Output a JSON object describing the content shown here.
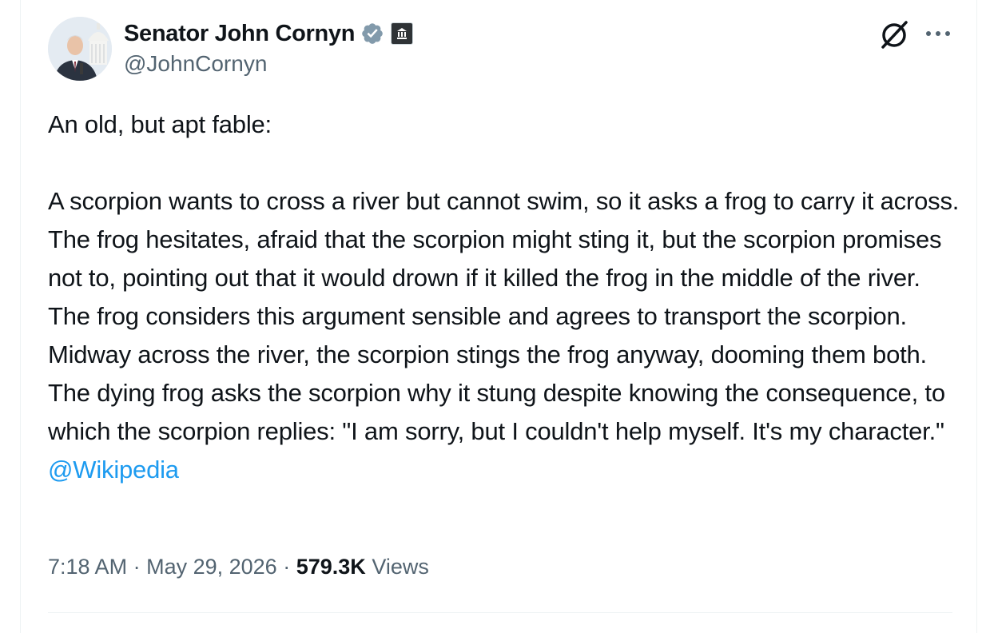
{
  "author": {
    "display_name": "Senator John Cornyn",
    "handle": "@JohnCornyn",
    "verified_icon": "verified-badge-icon",
    "affiliation_icon": "government-building-icon"
  },
  "tweet": {
    "intro": "An old, but apt fable:",
    "body": "A scorpion wants to cross a river but cannot swim, so it asks a frog to carry it across. The frog hesitates, afraid that the scorpion might sting it, but the scorpion promises not to, pointing out that it would drown if it killed the frog in the middle of the river. The frog considers this argument sensible and agrees to transport the scorpion. Midway across the river, the scorpion stings the frog anyway, dooming them both. The dying frog asks the scorpion why it stung despite knowing the consequence, to which the scorpion replies: \"I am sorry, but I couldn't help myself. It's my character.\"",
    "mention": "@Wikipedia"
  },
  "meta": {
    "time": "7:18 AM",
    "separator": "·",
    "date": "May 29, 2026",
    "views_count": "579.3K",
    "views_label": "Views"
  },
  "colors": {
    "link": "#1d9bf0",
    "secondary_text": "#536471",
    "verified": "#829aab"
  }
}
